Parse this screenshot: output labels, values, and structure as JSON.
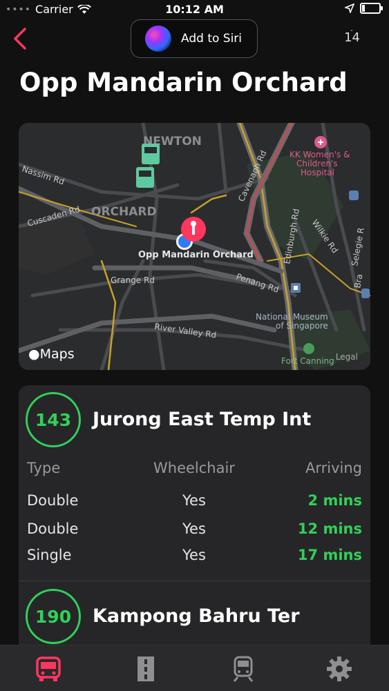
{
  "status_bar": {
    "carrier": "Carrier",
    "time": "10:12 AM"
  },
  "top_bar": {
    "siri_label": "Add to Siri",
    "count": "14"
  },
  "page_title": "Opp Mandarin Orchard",
  "map": {
    "labels": {
      "newton": "NEWTON",
      "orchard": "ORCHARD",
      "nassim": "Nassim Rd",
      "cuscaden": "Cuscaden Rd",
      "cavenagh": "Cavenagh Rd",
      "kk1": "KK Women's &",
      "kk2": "Children's",
      "kk3": "Hospital",
      "wilkie": "Wilkie Rd",
      "selegie": "Selegie R",
      "edinburgh": "Edinburgh Rd",
      "stop": "Opp Mandarin Orchard",
      "grange": "Grange Rd",
      "penang": "Penang Rd",
      "museum1": "National Museum",
      "museum2": "of Singapore",
      "river_valley": "River Valley Rd",
      "fort_canning": "Fort Canning",
      "bras": "Bra"
    },
    "maps_logo": "Maps",
    "legal": "Legal"
  },
  "services": {
    "headers": {
      "type": "Type",
      "wheelchair": "Wheelchair",
      "arriving": "Arriving"
    },
    "items": [
      {
        "number": "143",
        "destination": "Jurong East Temp Int",
        "rows": [
          {
            "type": "Double",
            "wheelchair": "Yes",
            "arriving": "2 mins"
          },
          {
            "type": "Double",
            "wheelchair": "Yes",
            "arriving": "12 mins"
          },
          {
            "type": "Single",
            "wheelchair": "Yes",
            "arriving": "17 mins"
          }
        ]
      },
      {
        "number": "190",
        "destination": "Kampong Bahru Ter"
      }
    ]
  },
  "tab_bar": {
    "icons": [
      "bus-icon",
      "road-icon",
      "train-icon",
      "gear-icon"
    ],
    "active_color": "#ff375f",
    "inactive_color": "#8e8e93"
  },
  "colors": {
    "accent_green": "#30d158",
    "accent_pink": "#ff375f"
  }
}
